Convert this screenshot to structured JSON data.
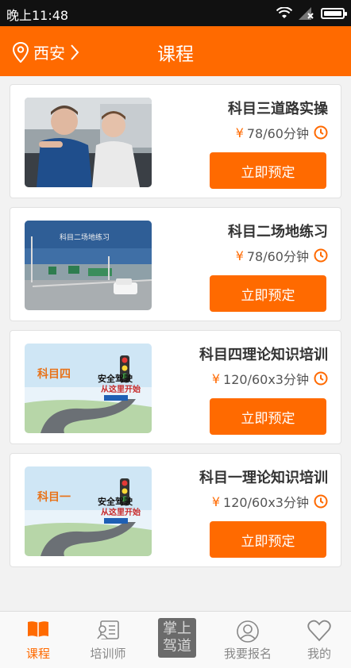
{
  "status_bar": {
    "time": "晚上11:48"
  },
  "header": {
    "city": "西安",
    "title": "课程"
  },
  "courses": [
    {
      "name": "科目三道路实操",
      "price": "78/60分钟",
      "button": "立即预定",
      "image_caption": ""
    },
    {
      "name": "科目二场地练习",
      "price": "78/60分钟",
      "button": "立即预定",
      "image_caption": "科目二场地练习"
    },
    {
      "name": "科目四理论知识培训",
      "price": "120/60x3分钟",
      "button": "立即预定",
      "image_caption": "科目四",
      "image_slogan_1": "安全驾驶",
      "image_slogan_2": "从这里开始"
    },
    {
      "name": "科目一理论知识培训",
      "price": "120/60x3分钟",
      "button": "立即预定",
      "image_caption": "科目一",
      "image_slogan_1": "安全驾驶",
      "image_slogan_2": "从这里开始"
    }
  ],
  "price_symbol": "¥",
  "tabs": [
    {
      "label": "课程",
      "icon": "book-icon",
      "active": true
    },
    {
      "label": "培训师",
      "icon": "trainer-card-icon",
      "active": false
    },
    {
      "label": "掌上驾道",
      "icon": "brand-stamp",
      "active": false
    },
    {
      "label": "我要报名",
      "icon": "user-icon",
      "active": false
    },
    {
      "label": "我的",
      "icon": "heart-icon",
      "active": false
    }
  ],
  "colors": {
    "accent": "#ff6a00",
    "status_bar": "#111111",
    "background": "#f2f2f2"
  }
}
